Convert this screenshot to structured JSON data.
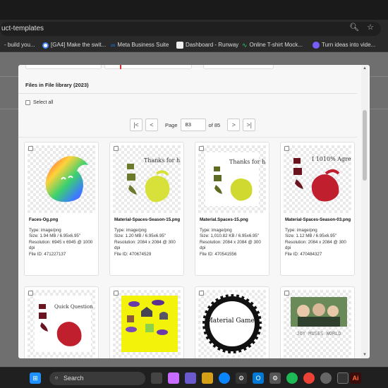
{
  "browser": {
    "url": "uct-templates",
    "bookmarks": [
      {
        "label": "- build you...",
        "icon": "doc-icon",
        "color": "#555"
      },
      {
        "label": "[GA4] Make the swit...",
        "icon": "google-icon",
        "color": "#4285f4"
      },
      {
        "label": "Meta Business Suite",
        "icon": "meta-icon",
        "color": "#1877f2"
      },
      {
        "label": "Dashboard - Runway",
        "icon": "runway-icon",
        "color": "#eee"
      },
      {
        "label": "Online T-shirt Mock...",
        "icon": "tshirt-icon",
        "color": "#2ecc71"
      },
      {
        "label": "Turn ideas into vide...",
        "icon": "video-icon",
        "color": "#7b5cff"
      }
    ]
  },
  "modal": {
    "section_title": "Files in File library (2023)",
    "select_all": "Select all",
    "pager": {
      "page_label": "Page",
      "current": "83",
      "of_label": "of 85",
      "first": "|<",
      "prev": "<",
      "next": ">",
      "last": ">|"
    },
    "files": [
      {
        "name": "Faces-Og.png",
        "type": "Type: image/png",
        "size": "Size: 1.94 MB / 6.95x6.95\"",
        "resolution": "Resolution: 6945 x 6945 @ 1000 dpi",
        "file_id": "File ID: 471227137"
      },
      {
        "name": "Material-Spaces-Season-15.png",
        "type": "Type: image/png",
        "size": "Size: 1.20 MB / 6.95x6.95\"",
        "resolution": "Resolution: 2084 x 2084 @ 300 dpi",
        "file_id": "File ID: 470674529"
      },
      {
        "name": "Material.Spaces-15.png",
        "type": "Type: image/png",
        "size": "Size: 1,010.82 KB / 6.95x6.95\"",
        "resolution": "Resolution: 2084 x 2084 @ 300 dpi",
        "file_id": "File ID: 470541556"
      },
      {
        "name": "Material-Spaces-Season-03.png",
        "type": "Type: image/png",
        "size": "Size: 1.12 MB / 6.95x6.95\"",
        "resolution": "Resolution: 2084 x 2084 @ 300 dpi",
        "file_id": "File ID: 470484327"
      }
    ],
    "thumb_texts": {
      "thanks_1": "Thanks for having me",
      "thanks_2": "Thanks for having me",
      "agree": "I 1010% Agree",
      "quick_question": "Quick Question",
      "material_games": "Material Games",
      "photo_caption": "JOY MUSES WORLD"
    }
  },
  "taskbar": {
    "search_label": "Search"
  }
}
